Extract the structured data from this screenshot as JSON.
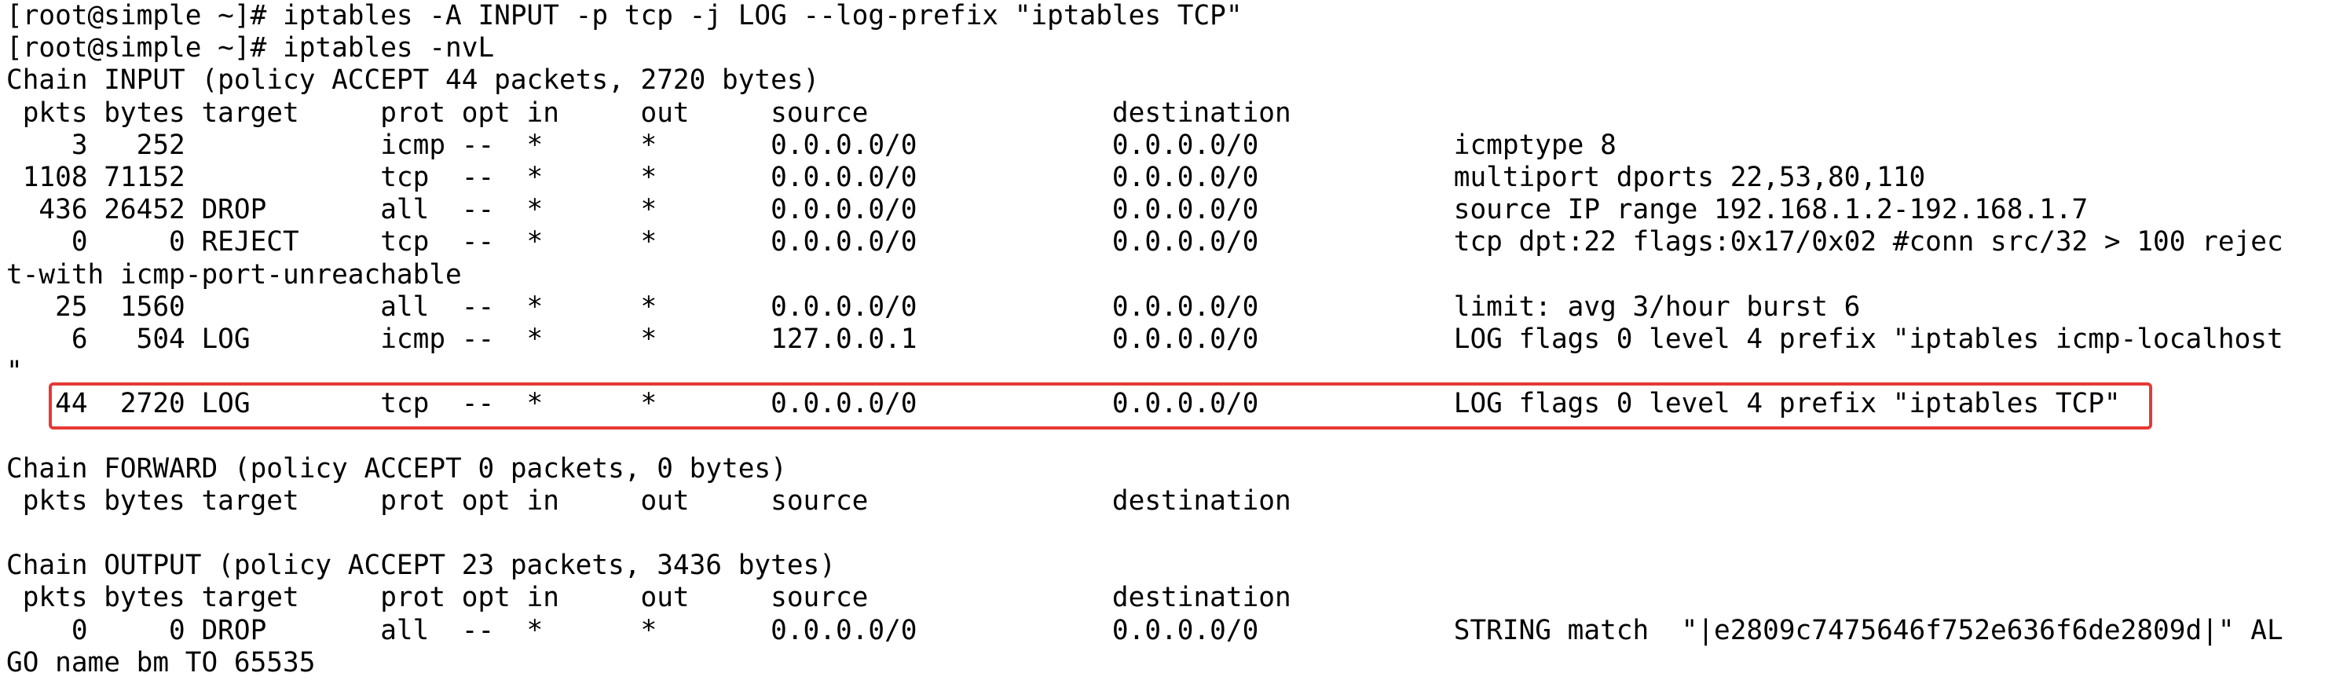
{
  "terminal": {
    "lines": [
      "[root@simple ~]# iptables -A INPUT -p tcp -j LOG --log-prefix \"iptables TCP\"",
      "[root@simple ~]# iptables -nvL",
      "Chain INPUT (policy ACCEPT 44 packets, 2720 bytes)",
      " pkts bytes target     prot opt in     out     source               destination",
      "    3   252            icmp --  *      *       0.0.0.0/0            0.0.0.0/0            icmptype 8",
      " 1108 71152            tcp  --  *      *       0.0.0.0/0            0.0.0.0/0            multiport dports 22,53,80,110",
      "  436 26452 DROP       all  --  *      *       0.0.0.0/0            0.0.0.0/0            source IP range 192.168.1.2-192.168.1.7",
      "    0     0 REJECT     tcp  --  *      *       0.0.0.0/0            0.0.0.0/0            tcp dpt:22 flags:0x17/0x02 #conn src/32 > 100 rejec",
      "t-with icmp-port-unreachable",
      "   25  1560            all  --  *      *       0.0.0.0/0            0.0.0.0/0            limit: avg 3/hour burst 6",
      "    6   504 LOG        icmp --  *      *       127.0.0.1            0.0.0.0/0            LOG flags 0 level 4 prefix \"iptables icmp-localhost",
      "\"",
      "   44  2720 LOG        tcp  --  *      *       0.0.0.0/0            0.0.0.0/0            LOG flags 0 level 4 prefix \"iptables TCP\"",
      "",
      "Chain FORWARD (policy ACCEPT 0 packets, 0 bytes)",
      " pkts bytes target     prot opt in     out     source               destination",
      "",
      "Chain OUTPUT (policy ACCEPT 23 packets, 3436 bytes)",
      " pkts bytes target     prot opt in     out     source               destination",
      "    0     0 DROP       all  --  *      *       0.0.0.0/0            0.0.0.0/0            STRING match  \"|e2809c7475646f752e636f6de2809d|\" AL",
      "GO name bm TO 65535"
    ]
  },
  "colors": {
    "background": "#ffffff",
    "text": "#000000",
    "highlight": "#e53935"
  }
}
